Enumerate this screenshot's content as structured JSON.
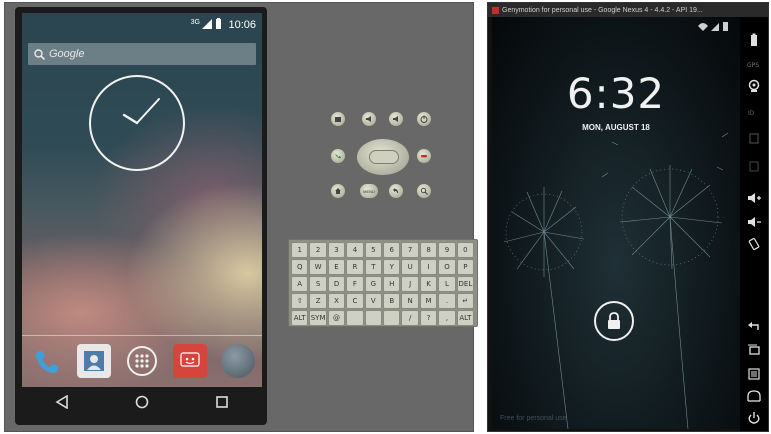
{
  "left_emulator": {
    "status_bar": {
      "signal_label": "3G",
      "time": "10:06"
    },
    "search_placeholder": "Google",
    "keyboard": {
      "rows": [
        [
          "1",
          "2",
          "3",
          "4",
          "5",
          "6",
          "7",
          "8",
          "9",
          "0"
        ],
        [
          "Q",
          "W",
          "E",
          "R",
          "T",
          "Y",
          "U",
          "I",
          "O",
          "P"
        ],
        [
          "A",
          "S",
          "D",
          "F",
          "G",
          "H",
          "J",
          "K",
          "L",
          "DEL"
        ],
        [
          "⇧",
          "Z",
          "X",
          "C",
          "V",
          "B",
          "N",
          "M",
          ".",
          "↵"
        ],
        [
          "ALT",
          "SYM",
          "@",
          "",
          "",
          "",
          "/",
          "?",
          ",",
          "ALT"
        ]
      ]
    },
    "controls": {
      "row1": [
        "camera",
        "vol-down",
        "vol-up",
        "power"
      ],
      "row2": [
        "call",
        "end-call"
      ],
      "row3": [
        "home",
        "menu",
        "back",
        "search"
      ],
      "menu_label": "MENU"
    }
  },
  "genymotion": {
    "title": "Genymotion for personal use - Google Nexus 4 - 4.4.2 - API 19...",
    "lock_time": "6:32",
    "lock_date": "MON, AUGUST 18",
    "watermark": "Free for personal use",
    "sidebar_icons": [
      "battery",
      "gps",
      "webcam",
      "id",
      "sd",
      "volume-up",
      "volume-down",
      "rotate",
      "back",
      "recent-apps",
      "menu",
      "home",
      "power"
    ]
  }
}
